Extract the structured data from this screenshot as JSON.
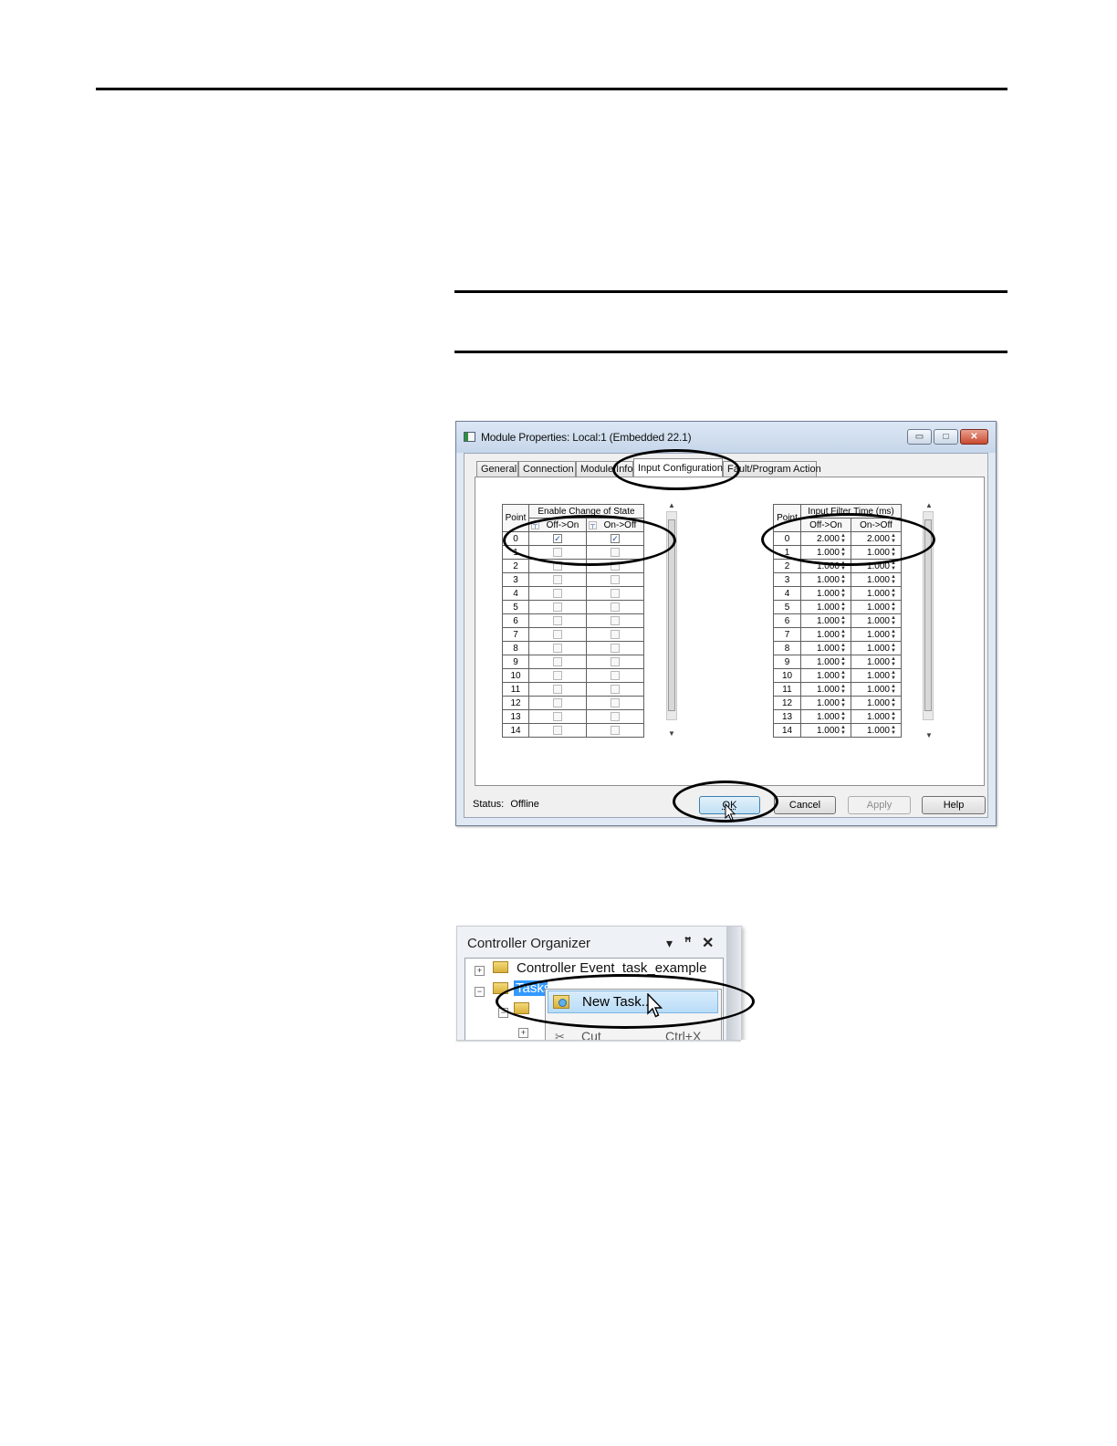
{
  "dialog": {
    "title": "Module Properties: Local:1 (Embedded 22.1)",
    "window_buttons": {
      "minimize": "▭",
      "maximize": "□",
      "close": "✕"
    },
    "tabs": [
      "General",
      "Connection",
      "Module Info",
      "Input Configuration",
      "Fault/Program Action"
    ],
    "active_tab": "Input Configuration",
    "cos_table": {
      "point_header": "Point",
      "group_header": "Enable Change of State",
      "col_off_on": "Off->On",
      "col_on_off": "On->Off",
      "rows": [
        {
          "point": "0",
          "off_on": true,
          "on_off": true
        },
        {
          "point": "1",
          "off_on": false,
          "on_off": false
        },
        {
          "point": "2",
          "off_on": false,
          "on_off": false
        },
        {
          "point": "3",
          "off_on": false,
          "on_off": false
        },
        {
          "point": "4",
          "off_on": false,
          "on_off": false
        },
        {
          "point": "5",
          "off_on": false,
          "on_off": false
        },
        {
          "point": "6",
          "off_on": false,
          "on_off": false
        },
        {
          "point": "7",
          "off_on": false,
          "on_off": false
        },
        {
          "point": "8",
          "off_on": false,
          "on_off": false
        },
        {
          "point": "9",
          "off_on": false,
          "on_off": false
        },
        {
          "point": "10",
          "off_on": false,
          "on_off": false
        },
        {
          "point": "11",
          "off_on": false,
          "on_off": false
        },
        {
          "point": "12",
          "off_on": false,
          "on_off": false
        },
        {
          "point": "13",
          "off_on": false,
          "on_off": false
        },
        {
          "point": "14",
          "off_on": false,
          "on_off": false
        }
      ]
    },
    "filter_table": {
      "point_header": "Point",
      "group_header": "Input Filter Time (ms)",
      "col_off_on": "Off->On",
      "col_on_off": "On->Off",
      "rows": [
        {
          "point": "0",
          "off_on": "2.000",
          "on_off": "2.000"
        },
        {
          "point": "1",
          "off_on": "1.000",
          "on_off": "1.000"
        },
        {
          "point": "2",
          "off_on": "1.000",
          "on_off": "1.000"
        },
        {
          "point": "3",
          "off_on": "1.000",
          "on_off": "1.000"
        },
        {
          "point": "4",
          "off_on": "1.000",
          "on_off": "1.000"
        },
        {
          "point": "5",
          "off_on": "1.000",
          "on_off": "1.000"
        },
        {
          "point": "6",
          "off_on": "1.000",
          "on_off": "1.000"
        },
        {
          "point": "7",
          "off_on": "1.000",
          "on_off": "1.000"
        },
        {
          "point": "8",
          "off_on": "1.000",
          "on_off": "1.000"
        },
        {
          "point": "9",
          "off_on": "1.000",
          "on_off": "1.000"
        },
        {
          "point": "10",
          "off_on": "1.000",
          "on_off": "1.000"
        },
        {
          "point": "11",
          "off_on": "1.000",
          "on_off": "1.000"
        },
        {
          "point": "12",
          "off_on": "1.000",
          "on_off": "1.000"
        },
        {
          "point": "13",
          "off_on": "1.000",
          "on_off": "1.000"
        },
        {
          "point": "14",
          "off_on": "1.000",
          "on_off": "1.000"
        }
      ]
    },
    "status_label": "Status:",
    "status_value": "Offline",
    "buttons": {
      "ok": "OK",
      "cancel": "Cancel",
      "apply": "Apply",
      "help": "Help"
    }
  },
  "organizer": {
    "title": "Controller Organizer",
    "title_icons": {
      "dropdown": "▾",
      "pin": "📌",
      "close": "✕"
    },
    "tree": {
      "controller_node": "Controller Event_task_example",
      "tasks_node": "Tasks"
    },
    "context_menu": {
      "new_task": "New Task...",
      "cut": "Cut",
      "cut_shortcut": "Ctrl+X"
    }
  }
}
